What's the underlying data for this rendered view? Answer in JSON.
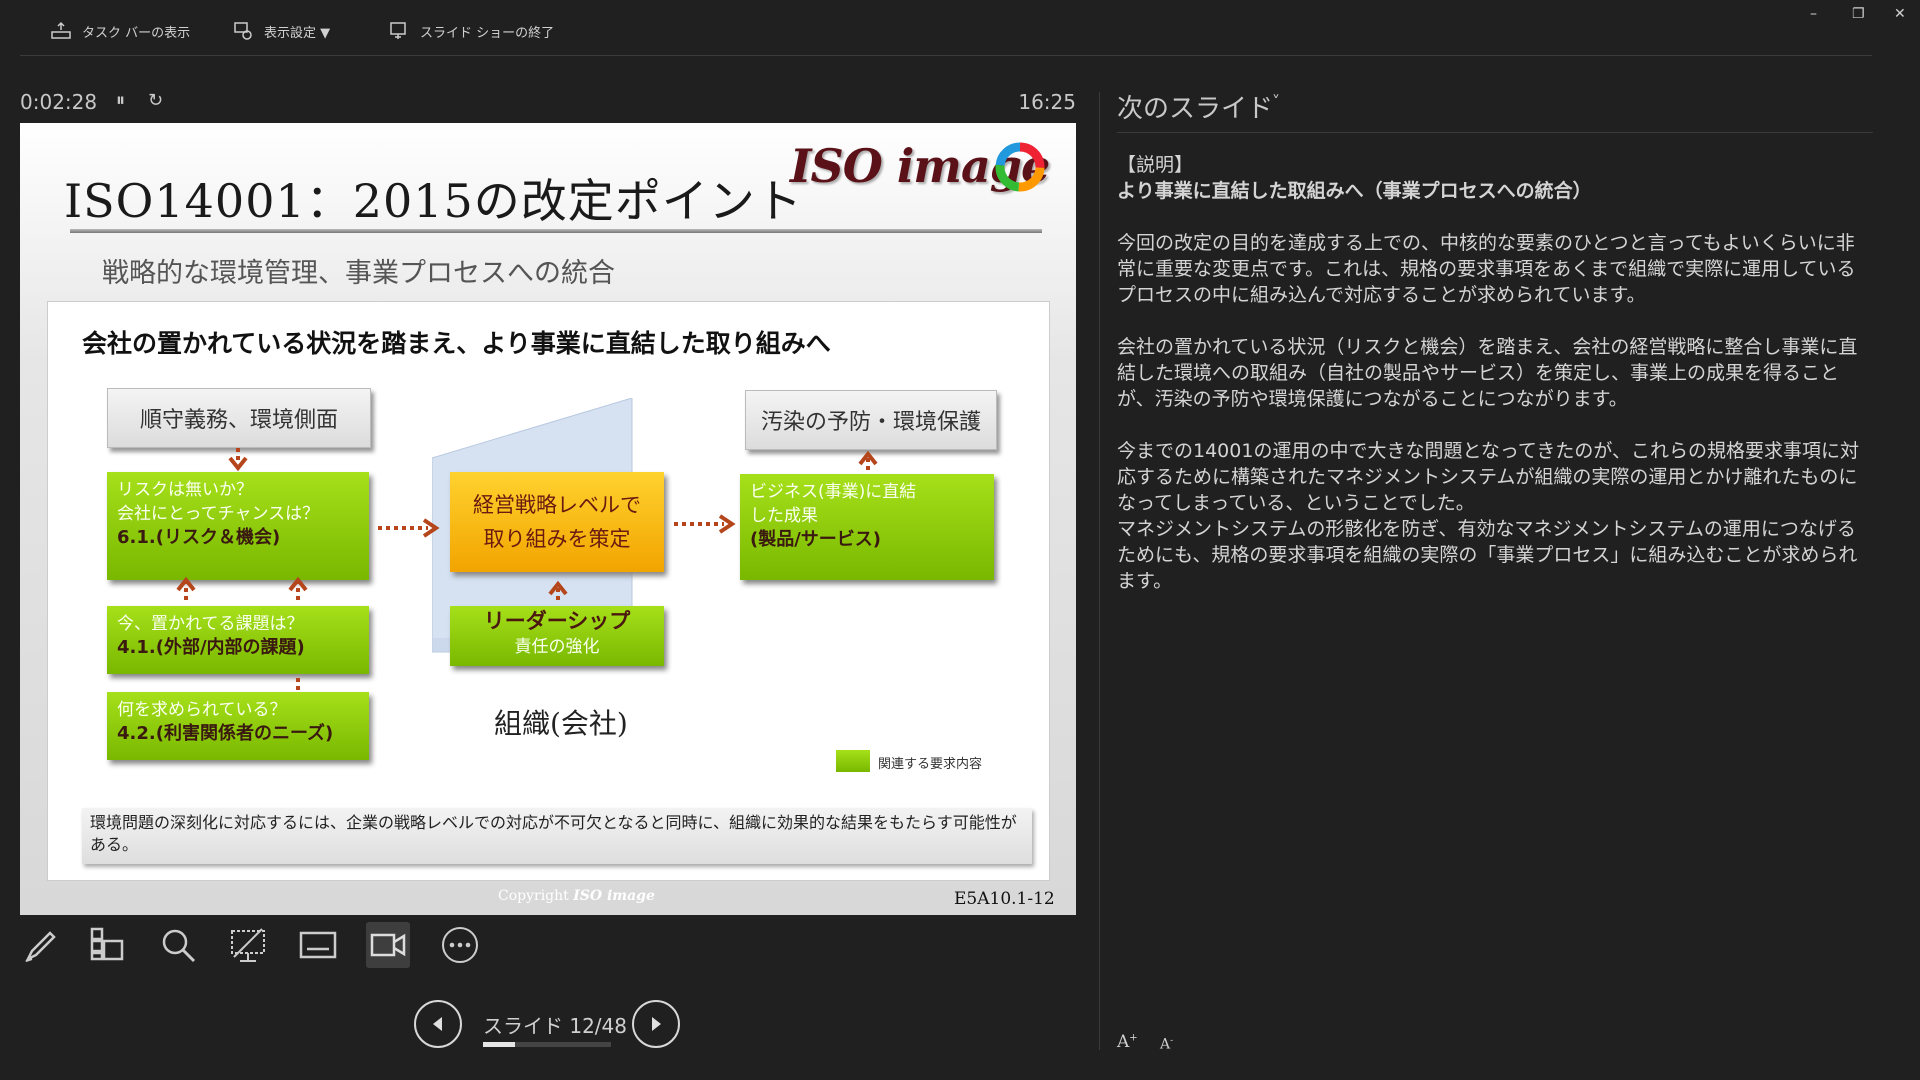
{
  "toolbar": {
    "taskbar_label": "タスク バーの表示",
    "display_label": "表示設定 ▼",
    "end_label": "スライド ショーの終了"
  },
  "window": {
    "minimize": "–",
    "restore": "❐",
    "close": "✕"
  },
  "timer": {
    "elapsed": "0:02:28",
    "pause_icon": "⏸",
    "reset_icon": "↻",
    "clock": "16:25"
  },
  "slide": {
    "title": "ISO14001：2015の改定ポイント",
    "subtitle": "戦略的な環境管理、事業プロセスへの統合",
    "logo": "ISO image",
    "heading": "会社の置かれている状況を踏まえ、より事業に直結した取り組みへ",
    "box_compliance": "順守義務、環境側面",
    "box_pollution": "汚染の予防・環境保護",
    "risk": {
      "line1": "リスクは無いか？",
      "line2": "会社にとってチャンスは？",
      "bold": "6.1.(リスク＆機会)"
    },
    "issues": {
      "line1": "今、置かれてる課題は？",
      "bold": "4.1.(外部/内部の課題)"
    },
    "needs": {
      "line1": "何を求められている？",
      "bold": "4.2.(利害関係者のニーズ)"
    },
    "strategy": {
      "line1": "経営戦略レベルで",
      "line2": "取り組みを策定"
    },
    "leadership": {
      "title": "リーダーシップ",
      "sub": "責任の強化"
    },
    "org_label": "組織(会社)",
    "business": {
      "line1": "ビジネス(事業)に直結",
      "line2": "した成果",
      "bold": "(製品/サービス)"
    },
    "legend": "関連する要求内容",
    "note": "環境問題の深刻化に対応するには、企業の戦略レベルでの対応が不可欠となると同時に、組織に効果的な結果をもたらす可能性がある。",
    "copyright_prefix": "Copyright",
    "copyright_brand": "ISO image",
    "code": "E5A10.1-12"
  },
  "tools": [
    "pen-tool",
    "see-all-slides",
    "zoom",
    "black-screen",
    "subtitles",
    "camera",
    "more-options"
  ],
  "nav": {
    "slide_counter": "スライド 12/48",
    "current": 12,
    "total": 48
  },
  "right": {
    "next_header": "次のスライド",
    "chevron": "˅",
    "notes_title1": "【説明】",
    "notes_title2": "より事業に直結した取組みへ（事業プロセスへの統合）",
    "para1": "今回の改定の目的を達成する上での、中核的な要素のひとつと言ってもよいくらいに非常に重要な変更点です。これは、規格の要求事項をあくまで組織で実際に運用しているプロセスの中に組み込んで対応することが求められています。",
    "para2": "会社の置かれている状況（リスクと機会）を踏まえ、会社の経営戦略に整合し事業に直結した環境への取組み（自社の製品やサービス）を策定し、事業上の成果を得ることが、汚染の予防や環境保護につながることにつながります。",
    "para3": "今までの14001の運用の中で大きな問題となってきたのが、これらの規格要求事項に対応するために構築されたマネジメントシステムが組織の実際の運用とかけ離れたものになってしまっている、ということでした。",
    "para4": "マネジメントシステムの形骸化を防ぎ、有効なマネジメントシステムの運用につなげるためにも、規格の要求事項を組織の実際の「事業プロセス」に組み込むことが求められます。",
    "font_up": "A",
    "font_down": "A"
  },
  "colors": {
    "background": "#202020",
    "green": "#8cc70a",
    "orange": "#f5b800",
    "arrow": "#b5451b"
  }
}
